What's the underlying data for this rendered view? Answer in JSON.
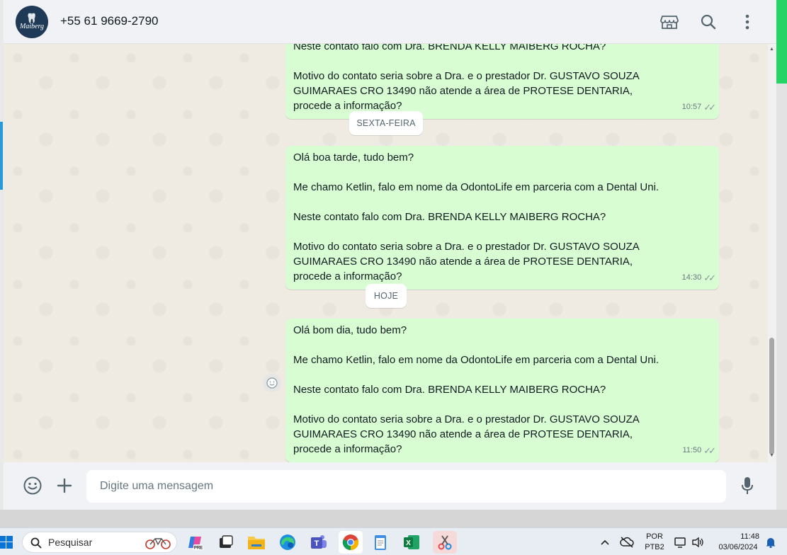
{
  "header": {
    "contact_name": "+55 61 9669-2790",
    "avatar_brand": "Maiberg"
  },
  "messages": [
    {
      "lines": [
        "Neste contato falo com Dra. BRENDA KELLY MAIBERG ROCHA?",
        "",
        "Motivo do contato seria sobre a Dra. e o prestador Dr. GUSTAVO SOUZA GUIMARAES CRO 13490 não atende a área de PROTESE DENTARIA, procede a informação?"
      ],
      "time": "10:57"
    },
    {
      "lines": [
        "Olá boa tarde, tudo bem?",
        "",
        "Me chamo Ketlin, falo em nome da OdontoLife em parceria com a Dental Uni.",
        "",
        "Neste contato falo com Dra. BRENDA KELLY MAIBERG ROCHA?",
        "",
        "Motivo do contato seria sobre a Dra. e o prestador Dr. GUSTAVO SOUZA GUIMARAES CRO 13490 não atende a área de PROTESE DENTARIA, procede a informação?"
      ],
      "time": "14:30"
    },
    {
      "lines": [
        "Olá bom dia, tudo bem?",
        "",
        "Me chamo Ketlin, falo em nome da OdontoLife em parceria com a Dental Uni.",
        "",
        "Neste contato falo com Dra. BRENDA KELLY MAIBERG ROCHA?",
        "",
        "Motivo do contato seria sobre a Dra. e o prestador Dr. GUSTAVO SOUZA GUIMARAES CRO 13490 não atende a área de PROTESE DENTARIA, procede a informação?"
      ],
      "time": "11:50"
    }
  ],
  "date_chips": [
    "SEXTA-FEIRA",
    "HOJE"
  ],
  "composer": {
    "placeholder": "Digite uma mensagem"
  },
  "taskbar": {
    "search_label": "Pesquisar",
    "lang_line1": "POR",
    "lang_line2": "PTB2",
    "time": "11:48",
    "date": "03/06/2024"
  },
  "colors": {
    "bubble_out": "#d9fdd3",
    "chat_bg": "#efeae2",
    "accent": "#25d366"
  }
}
